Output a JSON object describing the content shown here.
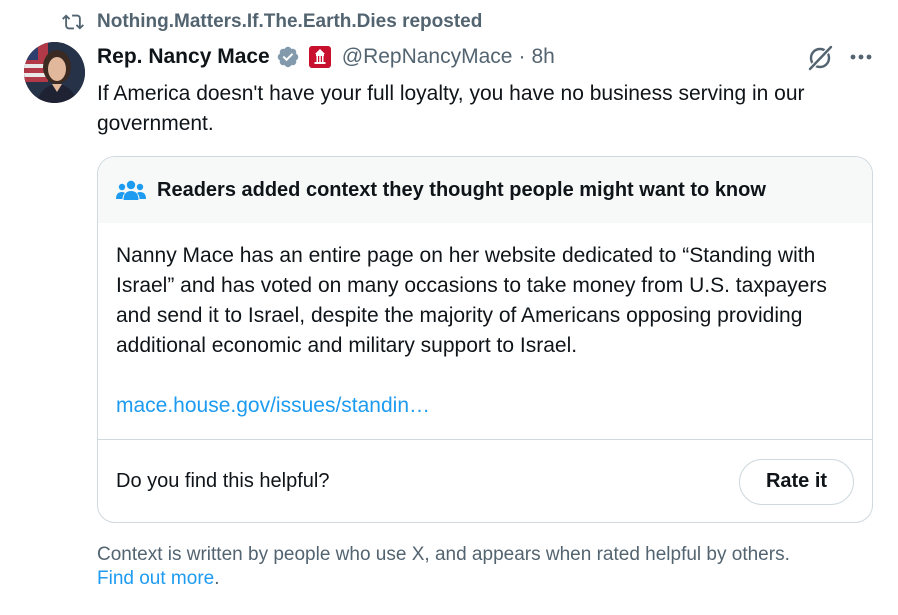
{
  "repost": {
    "icon": "repost-icon",
    "text": "Nothing.Matters.If.The.Earth.Dies reposted"
  },
  "author": {
    "avatar": "avatar",
    "display_name": "Rep. Nancy Mace",
    "verified_icon": "verified-badge-icon",
    "affiliation_icon": "affiliation-badge-icon",
    "handle": "@RepNancyMace",
    "separator": "·",
    "time": "8h"
  },
  "actions": {
    "grok_icon": "grok-icon",
    "more_icon": "more-icon"
  },
  "tweet": {
    "text": "If America doesn't have your full loyalty, you have no business serving in our government."
  },
  "community_note": {
    "icon": "people-icon",
    "title": "Readers added context they thought people might want to know",
    "body": "Nanny Mace has an entire page on her website dedicated to “Standing with Israel” and has voted on many occasions to take money from U.S. taxpayers and send it to Israel, despite the majority of Americans opposing providing additional economic and military support to Israel.",
    "link": "mace.house.gov/issues/standin…",
    "question": "Do you find this helpful?",
    "rate_label": "Rate it"
  },
  "disclaimer": {
    "text": "Context is written by people who use X, and appears when rated helpful by others.",
    "link": "Find out more",
    "suffix": "."
  },
  "colors": {
    "text_primary": "#0f1419",
    "text_secondary": "#536471",
    "link": "#1d9bf0",
    "border": "#cfd9de",
    "note_header_bg": "#f7f9f9",
    "verified": "#829aab",
    "affiliation": "#c8102e"
  }
}
